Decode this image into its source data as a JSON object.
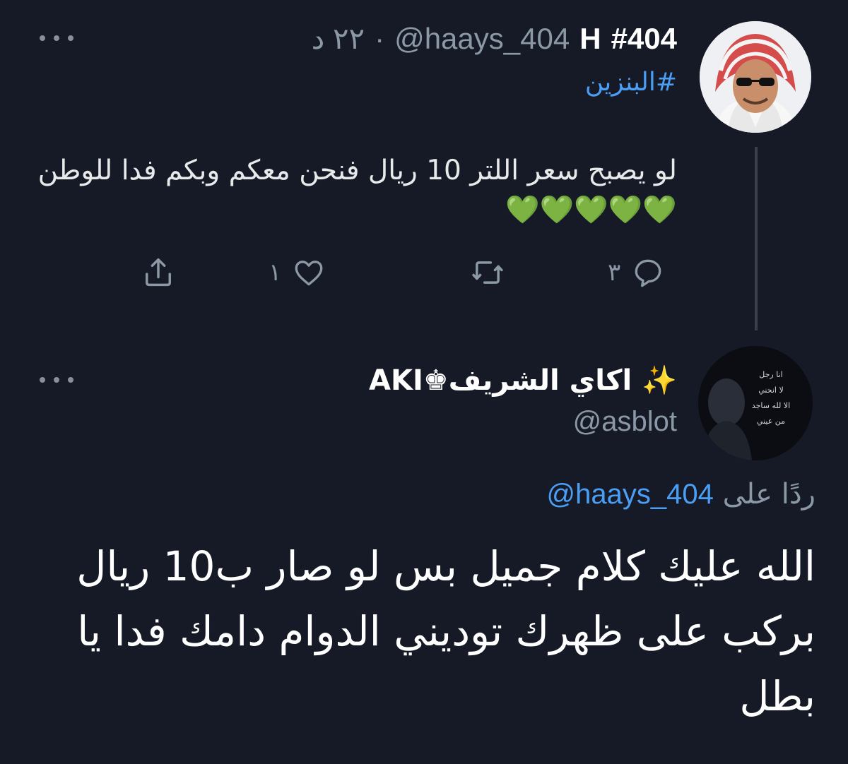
{
  "tweet1": {
    "name": "#404",
    "badge": "H",
    "handle": "@haays_404",
    "separator": "·",
    "time": "٢٢ د",
    "hashtag": "#البنزين",
    "text": "لو يصبح سعر اللتر 10 ريال فنحن معكم وبكم فدا للوطن",
    "hearts": "💚💚💚💚💚",
    "reply_count": "٣",
    "retweet_count": "",
    "like_count": "١"
  },
  "tweet2": {
    "name": "✨ اكاي الشريف♚AKI",
    "handle": "@asblot",
    "replying_prefix": "ردًا على",
    "replying_to": "@haays_404",
    "text": "الله عليك كلام جميل بس لو صار ب10 ريال بركب على ظهرك توديني الدوام دامك فدا يا بطل",
    "avatar_text": [
      "انا رجل",
      "لا انحني",
      "الا لله ساجد",
      "من عيني"
    ]
  },
  "colors": {
    "background": "#151a26",
    "accent": "#4a9ff5",
    "muted": "#8b98a5",
    "heart": "#7cd64a"
  },
  "icons": [
    "more-icon",
    "reply-icon",
    "retweet-icon",
    "like-icon",
    "share-icon"
  ]
}
